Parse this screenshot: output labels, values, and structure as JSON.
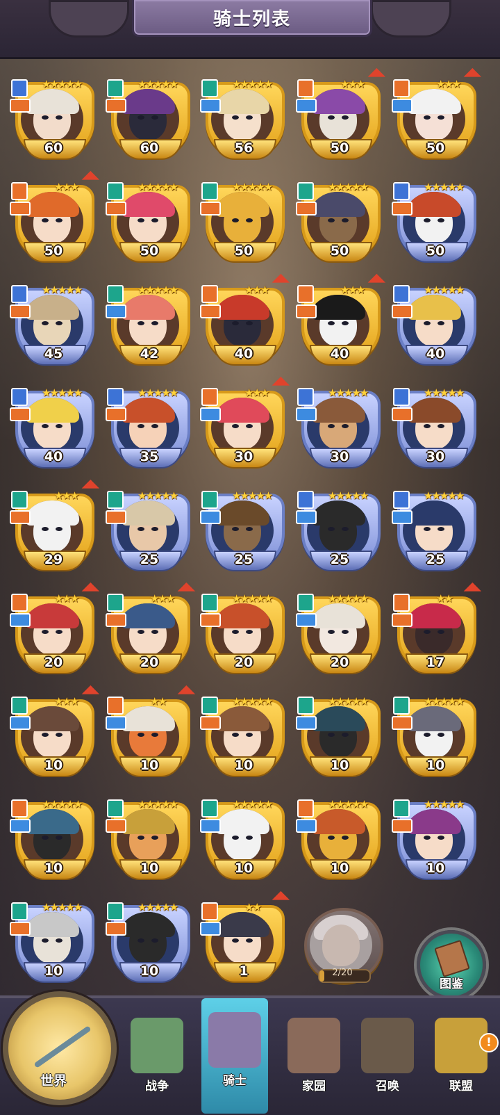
{
  "header": {
    "title": "骑士列表"
  },
  "colors": {
    "gold_frame": "#d79a1a",
    "blue_frame": "#6b7fc6",
    "rank_up_arrow": "#e0432c",
    "nav_active": "#3aa8c8"
  },
  "knights": [
    {
      "level": "60",
      "stars": "★★★★★",
      "frame": "gold",
      "cls": "blue",
      "role": "orange",
      "rank_up": false,
      "hair": "#e8e2d8",
      "skin": "#f2dccb"
    },
    {
      "level": "60",
      "stars": "★★★★★",
      "frame": "gold",
      "cls": "teal",
      "role": "orange",
      "rank_up": false,
      "hair": "#6a3a8a",
      "skin": "#2a2a3a"
    },
    {
      "level": "56",
      "stars": "★★★★★",
      "frame": "gold",
      "cls": "teal",
      "role": "blue",
      "rank_up": false,
      "hair": "#e8d6a8",
      "skin": "#f5e0cc"
    },
    {
      "level": "50",
      "stars": "★★★",
      "frame": "gold",
      "cls": "orange",
      "role": "blue",
      "rank_up": true,
      "hair": "#8a4aa8",
      "skin": "#e8e2d8"
    },
    {
      "level": "50",
      "stars": "★★★",
      "frame": "gold",
      "cls": "orange",
      "role": "blue",
      "rank_up": true,
      "hair": "#f2f2f2",
      "skin": "#f5e0d6"
    },
    {
      "level": "50",
      "stars": "★★★",
      "frame": "gold",
      "cls": "orange",
      "role": "orange",
      "rank_up": true,
      "hair": "#e06a2a",
      "skin": "#f6dcc8"
    },
    {
      "level": "50",
      "stars": "★★★★★",
      "frame": "gold",
      "cls": "teal",
      "role": "orange",
      "rank_up": false,
      "hair": "#e04a6a",
      "skin": "#f6dcc8"
    },
    {
      "level": "50",
      "stars": "★★★★★",
      "frame": "gold",
      "cls": "teal",
      "role": "orange",
      "rank_up": false,
      "hair": "#e8b03a",
      "skin": "#e8b03a"
    },
    {
      "level": "50",
      "stars": "★★★★★",
      "frame": "gold",
      "cls": "teal",
      "role": "orange",
      "rank_up": false,
      "hair": "#4a4a6a",
      "skin": "#8a6a4a"
    },
    {
      "level": "50",
      "stars": "★★★★★",
      "frame": "blue",
      "cls": "blue",
      "role": "orange",
      "rank_up": false,
      "hair": "#c84a2a",
      "skin": "#f2f2f2"
    },
    {
      "level": "45",
      "stars": "★★★★★",
      "frame": "blue",
      "cls": "blue",
      "role": "orange",
      "rank_up": false,
      "hair": "#c8b08a",
      "skin": "#e8d6b8"
    },
    {
      "level": "42",
      "stars": "★★★★★",
      "frame": "gold",
      "cls": "teal",
      "role": "blue",
      "rank_up": false,
      "hair": "#e87a6a",
      "skin": "#f6dcc8"
    },
    {
      "level": "40",
      "stars": "★★★",
      "frame": "gold",
      "cls": "orange",
      "role": "orange",
      "rank_up": true,
      "hair": "#c83a2a",
      "skin": "#2a2a3a"
    },
    {
      "level": "40",
      "stars": "★★★",
      "frame": "gold",
      "cls": "orange",
      "role": "orange",
      "rank_up": true,
      "hair": "#1a1a1a",
      "skin": "#f2f2f2"
    },
    {
      "level": "40",
      "stars": "★★★★★",
      "frame": "blue",
      "cls": "blue",
      "role": "orange",
      "rank_up": false,
      "hair": "#e8c04a",
      "skin": "#f6dcc8"
    },
    {
      "level": "40",
      "stars": "★★★★★",
      "frame": "blue",
      "cls": "blue",
      "role": "orange",
      "rank_up": false,
      "hair": "#f0d04a",
      "skin": "#f6dcc8"
    },
    {
      "level": "35",
      "stars": "★★★★★",
      "frame": "blue",
      "cls": "blue",
      "role": "orange",
      "rank_up": false,
      "hair": "#c8502a",
      "skin": "#f6d2b8"
    },
    {
      "level": "30",
      "stars": "★★★",
      "frame": "gold",
      "cls": "orange",
      "role": "blue",
      "rank_up": true,
      "hair": "#e04a5a",
      "skin": "#f6dcc8"
    },
    {
      "level": "30",
      "stars": "★★★★★",
      "frame": "blue",
      "cls": "blue",
      "role": "blue",
      "rank_up": false,
      "hair": "#8a5a3a",
      "skin": "#d8a878"
    },
    {
      "level": "30",
      "stars": "★★★★★",
      "frame": "blue",
      "cls": "blue",
      "role": "orange",
      "rank_up": false,
      "hair": "#8a4a2a",
      "skin": "#f6dcc8"
    },
    {
      "level": "29",
      "stars": "★★★",
      "frame": "gold",
      "cls": "teal",
      "role": "orange",
      "rank_up": true,
      "hair": "#f2f2f2",
      "skin": "#f2f2f2"
    },
    {
      "level": "25",
      "stars": "★★★★★",
      "frame": "blue",
      "cls": "teal",
      "role": "orange",
      "rank_up": false,
      "hair": "#d8c8a8",
      "skin": "#e8c8a8"
    },
    {
      "level": "25",
      "stars": "★★★★★",
      "frame": "blue",
      "cls": "teal",
      "role": "blue",
      "rank_up": false,
      "hair": "#6a4a2a",
      "skin": "#8a6a4a"
    },
    {
      "level": "25",
      "stars": "★★★★★",
      "frame": "blue",
      "cls": "blue",
      "role": "blue",
      "rank_up": false,
      "hair": "#2a2a2a",
      "skin": "#2a2a2a"
    },
    {
      "level": "25",
      "stars": "★★★★★",
      "frame": "blue",
      "cls": "blue",
      "role": "blue",
      "rank_up": false,
      "hair": "#2a3a6a",
      "skin": "#f6dcc8"
    },
    {
      "level": "20",
      "stars": "★★★",
      "frame": "gold",
      "cls": "orange",
      "role": "blue",
      "rank_up": true,
      "hair": "#c83a3a",
      "skin": "#f6dcc8"
    },
    {
      "level": "20",
      "stars": "★★★",
      "frame": "gold",
      "cls": "teal",
      "role": "orange",
      "rank_up": true,
      "hair": "#3a5a8a",
      "skin": "#f6dcc8"
    },
    {
      "level": "20",
      "stars": "★★★★★",
      "frame": "gold",
      "cls": "teal",
      "role": "orange",
      "rank_up": false,
      "hair": "#c8502a",
      "skin": "#f6dcc8"
    },
    {
      "level": "20",
      "stars": "★★★★★",
      "frame": "gold",
      "cls": "teal",
      "role": "blue",
      "rank_up": false,
      "hair": "#e8e2d8",
      "skin": "#f2e8e0"
    },
    {
      "level": "17",
      "stars": "★★",
      "frame": "gold",
      "cls": "orange",
      "role": "orange",
      "rank_up": true,
      "hair": "#c82a4a",
      "skin": "#3a2a2a"
    },
    {
      "level": "10",
      "stars": "★★★",
      "frame": "gold",
      "cls": "teal",
      "role": "blue",
      "rank_up": true,
      "hair": "#6a4a3a",
      "skin": "#f6dcc8"
    },
    {
      "level": "10",
      "stars": "★★",
      "frame": "gold",
      "cls": "orange",
      "role": "blue",
      "rank_up": true,
      "hair": "#e8e2d8",
      "skin": "#e87a3a"
    },
    {
      "level": "10",
      "stars": "★★★★★",
      "frame": "gold",
      "cls": "teal",
      "role": "orange",
      "rank_up": false,
      "hair": "#8a5a3a",
      "skin": "#f6dcc8"
    },
    {
      "level": "10",
      "stars": "★★★★★",
      "frame": "gold",
      "cls": "teal",
      "role": "blue",
      "rank_up": false,
      "hair": "#2a4a5a",
      "skin": "#2a2a2a"
    },
    {
      "level": "10",
      "stars": "★★★★★",
      "frame": "gold",
      "cls": "teal",
      "role": "orange",
      "rank_up": false,
      "hair": "#6a6a7a",
      "skin": "#f2f2f2"
    },
    {
      "level": "10",
      "stars": "★★★★★",
      "frame": "gold",
      "cls": "orange",
      "role": "blue",
      "rank_up": false,
      "hair": "#3a6a8a",
      "skin": "#2a2a2a"
    },
    {
      "level": "10",
      "stars": "★★★★★",
      "frame": "gold",
      "cls": "teal",
      "role": "orange",
      "rank_up": false,
      "hair": "#c8a03a",
      "skin": "#e8a05a"
    },
    {
      "level": "10",
      "stars": "★★★★★",
      "frame": "gold",
      "cls": "teal",
      "role": "blue",
      "rank_up": false,
      "hair": "#f2f2f2",
      "skin": "#f2f2f2"
    },
    {
      "level": "10",
      "stars": "★★★★★",
      "frame": "gold",
      "cls": "orange",
      "role": "blue",
      "rank_up": false,
      "hair": "#c85a2a",
      "skin": "#e8b03a"
    },
    {
      "level": "10",
      "stars": "★★★★★",
      "frame": "blue",
      "cls": "teal",
      "role": "orange",
      "rank_up": false,
      "hair": "#8a3a8a",
      "skin": "#f6dcc8"
    },
    {
      "level": "10",
      "stars": "★★★★★",
      "frame": "blue",
      "cls": "teal",
      "role": "orange",
      "rank_up": false,
      "hair": "#c8c8c8",
      "skin": "#e8e2d8"
    },
    {
      "level": "10",
      "stars": "★★★★★",
      "frame": "blue",
      "cls": "teal",
      "role": "orange",
      "rank_up": false,
      "hair": "#2a2a2a",
      "skin": "#2a2a2a"
    },
    {
      "level": "1",
      "stars": "★★",
      "frame": "gold",
      "cls": "orange",
      "role": "blue",
      "rank_up": true,
      "hair": "#3a3a4a",
      "skin": "#f6dcc8"
    }
  ],
  "fragment_card": {
    "progress_text": "2/20",
    "progress": 0.1
  },
  "compendium": {
    "label": "图鉴"
  },
  "nav": {
    "world": "世界",
    "items": [
      {
        "label": "战争",
        "color": "#6a9a6a"
      },
      {
        "label": "骑士",
        "color": "#8a7aa8"
      },
      {
        "label": "家园",
        "color": "#8a6a5a"
      },
      {
        "label": "召唤",
        "color": "#6a5a4a"
      },
      {
        "label": "联盟",
        "color": "#c8a03a"
      }
    ],
    "alert": "!"
  }
}
